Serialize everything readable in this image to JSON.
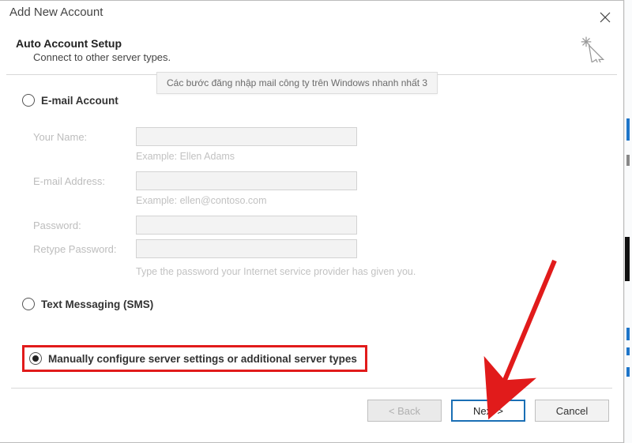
{
  "window": {
    "title": "Add New Account"
  },
  "header": {
    "title": "Auto Account Setup",
    "subtitle": "Connect to other server types."
  },
  "tooltip": {
    "text": "Các bước đăng nhập mail công ty trên Windows nhanh nhất 3"
  },
  "options": {
    "email_account": "E-mail Account",
    "text_messaging": "Text Messaging (SMS)",
    "manual": "Manually configure server settings or additional server types"
  },
  "form": {
    "your_name_label": "Your Name:",
    "your_name_example": "Example: Ellen Adams",
    "email_label": "E-mail Address:",
    "email_example": "Example: ellen@contoso.com",
    "password_label": "Password:",
    "retype_password_label": "Retype Password:",
    "password_hint": "Type the password your Internet service provider has given you."
  },
  "buttons": {
    "back": "< Back",
    "next": "Next >",
    "cancel": "Cancel"
  }
}
